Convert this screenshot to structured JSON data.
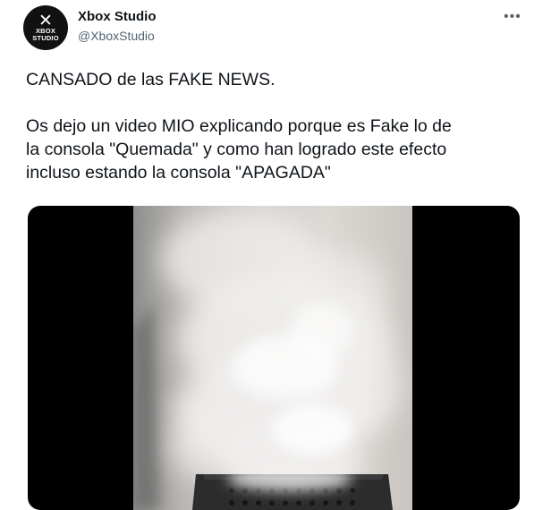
{
  "author": {
    "name": "Xbox Studio",
    "handle": "@XboxStudio",
    "avatar": {
      "icon": "xbox-logo-icon",
      "wordmark": [
        "XBOX",
        "STUDIO"
      ]
    }
  },
  "more_icon": "more-options-icon",
  "tweet": {
    "paragraph_1": "CANSADO de las FAKE NEWS.",
    "paragraph_2_lines": [
      "Os dejo un video MIO explicando porque es Fake lo de",
      "la consola \"Quemada\" y como han logrado este efecto",
      "incluso estando la consola \"APAGADA\""
    ]
  },
  "media": {
    "type": "video-thumbnail"
  }
}
